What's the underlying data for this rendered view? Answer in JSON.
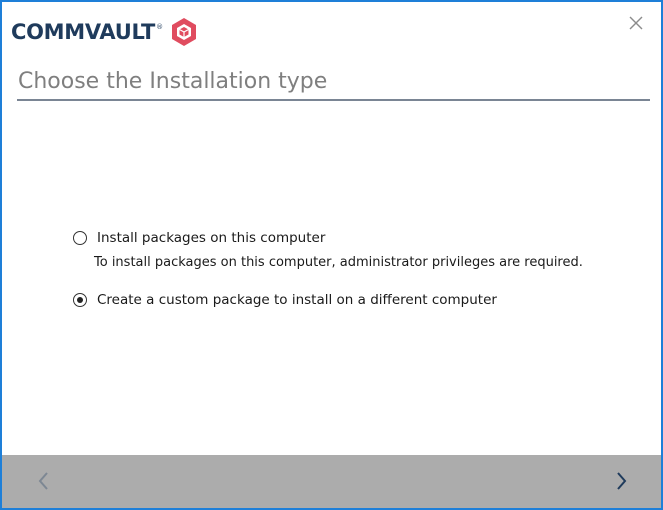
{
  "logo": {
    "text": "COMMVAULT",
    "trademark": "®"
  },
  "window": {
    "close_icon": "close-icon"
  },
  "page": {
    "title": "Choose the Installation type"
  },
  "options": [
    {
      "label": "Install packages on this computer",
      "description": "To install packages on this computer, administrator privileges are required.",
      "selected": false
    },
    {
      "label": "Create a custom package to install on a different computer",
      "selected": true
    }
  ],
  "footer": {
    "back_icon": "chevron-left-icon",
    "next_icon": "chevron-right-icon"
  },
  "colors": {
    "window_border": "#1e7fd8",
    "logo_text": "#1f3b5c",
    "logo_cube": "#e04c5f",
    "title_text": "#7f7f7f",
    "footer_bg": "#acacac",
    "back_arrow": "#7d8793",
    "next_arrow": "#1f3b5c"
  }
}
